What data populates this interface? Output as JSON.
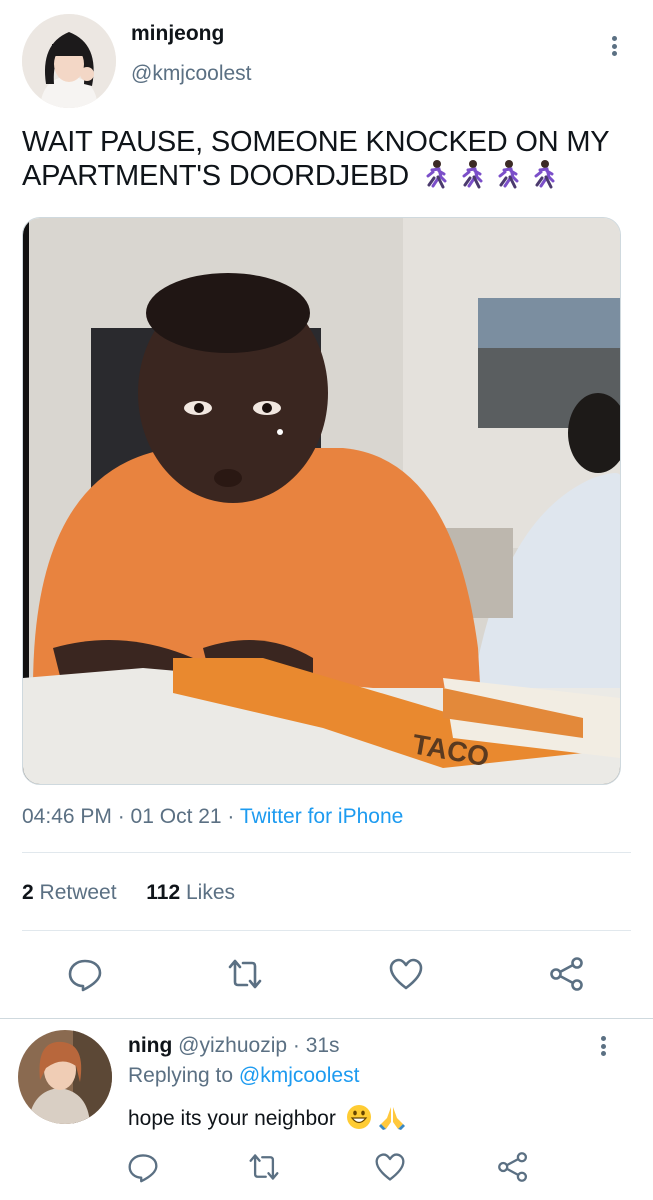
{
  "tweet": {
    "author": {
      "name": "minjeong",
      "handle": "@kmjcoolest"
    },
    "text": "WAIT PAUSE, SOMEONE KNOCKED ON MY APARTMENT'S DOORDJEBD",
    "emoji": [
      "runner-emoji",
      "runner-emoji",
      "runner-emoji",
      "runner-emoji"
    ],
    "timestamp": "04:46 PM · 01 Oct 21 · ",
    "source": "Twitter for iPhone",
    "retweets_count": "2",
    "retweets_label": "Retweet",
    "likes_count": "112",
    "likes_label": "Likes",
    "media_caption": "TACO"
  },
  "actions": [
    "reply-icon",
    "retweet-icon",
    "like-icon",
    "share-icon"
  ],
  "reply": {
    "name": "ning",
    "handle_time": "@yizhuozip · 31s",
    "replying_label": "Replying to ",
    "replying_to": "@kmjcoolest",
    "text": "hope its your neighbor"
  },
  "colors": {
    "link": "#1d9bf0",
    "muted": "#5b7083",
    "text": "#0f1419",
    "divider": "#e1e8ed"
  }
}
